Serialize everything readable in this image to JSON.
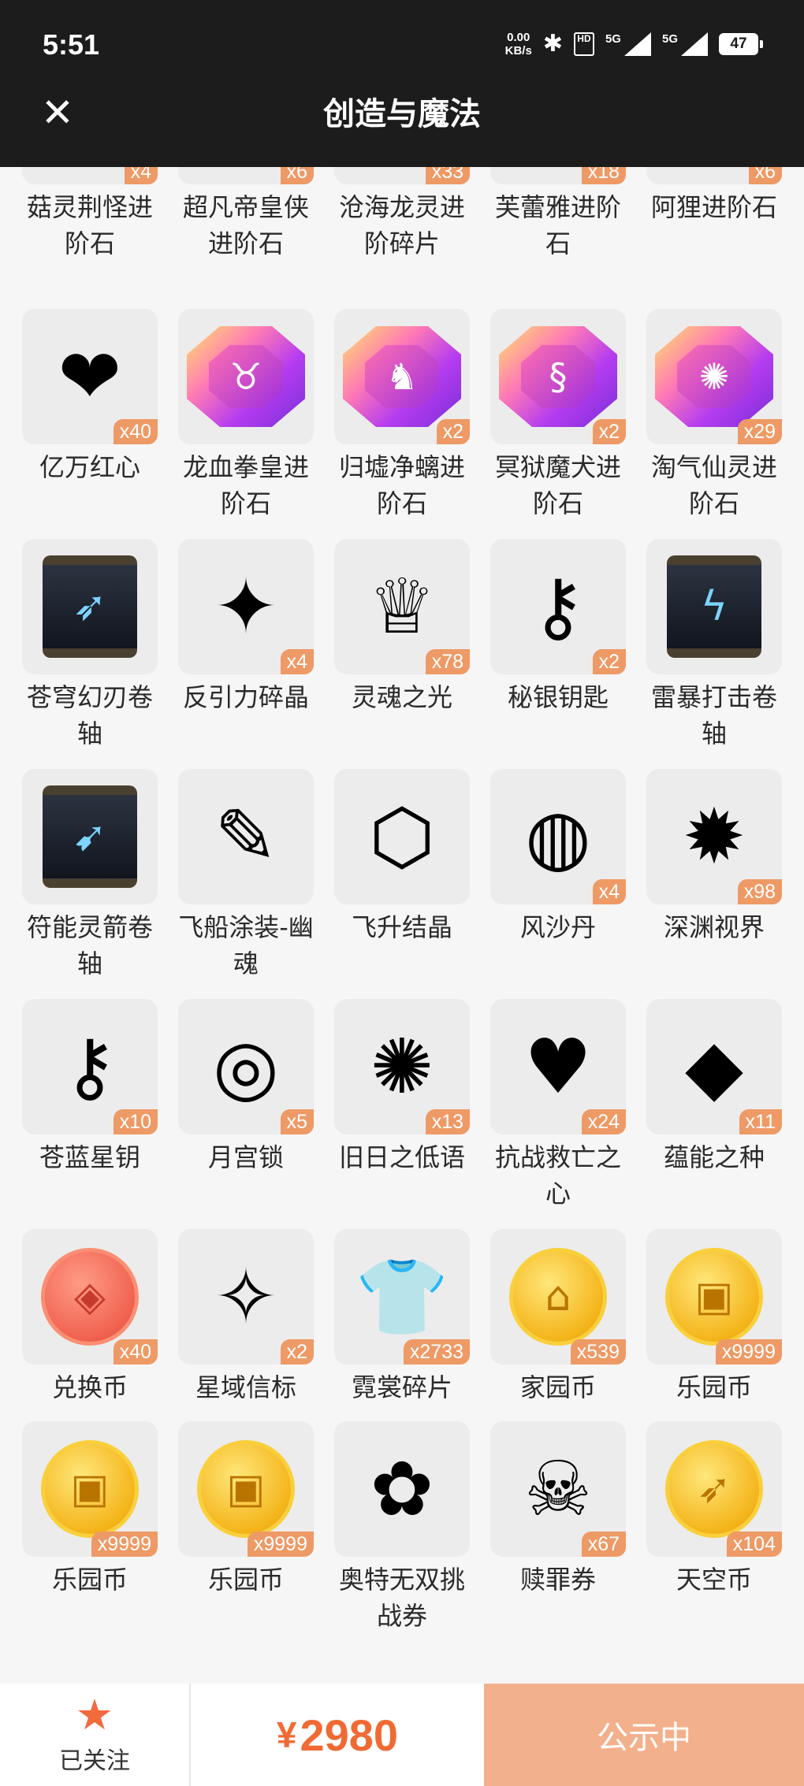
{
  "status_bar": {
    "time": "5:51",
    "net_speed_value": "0.00",
    "net_speed_unit": "KB/s",
    "bluetooth_icon": "bluetooth-icon",
    "hd_label": "HD",
    "signal1_label": "5G",
    "signal2_label": "5G",
    "battery": "47"
  },
  "header": {
    "close_icon": "✕",
    "title": "创造与魔法"
  },
  "items": [
    {
      "name": "菇灵荆怪进阶石",
      "count": "x4",
      "icon": "gem",
      "glyph": "♆"
    },
    {
      "name": "超凡帝皇侠进阶石",
      "count": "x6",
      "icon": "gem",
      "glyph": "♛"
    },
    {
      "name": "沧海龙灵进阶碎片",
      "count": "x33",
      "icon": "gem",
      "glyph": "♒"
    },
    {
      "name": "芙蕾雅进阶石",
      "count": "x18",
      "icon": "gem",
      "glyph": "❀"
    },
    {
      "name": "阿狸进阶石",
      "count": "x6",
      "icon": "gem",
      "glyph": "☾"
    },
    {
      "name": "亿万红心",
      "count": "x40",
      "icon": "emoji",
      "glyph": "❤"
    },
    {
      "name": "龙血拳皇进阶石",
      "count": "",
      "icon": "gem",
      "glyph": "♉"
    },
    {
      "name": "归墟净螭进阶石",
      "count": "x2",
      "icon": "gem",
      "glyph": "♞"
    },
    {
      "name": "冥狱魔犬进阶石",
      "count": "x2",
      "icon": "gem",
      "glyph": "§"
    },
    {
      "name": "淘气仙灵进阶石",
      "count": "x29",
      "icon": "gem",
      "glyph": "✺"
    },
    {
      "name": "苍穹幻刃卷轴",
      "count": "",
      "icon": "scroll",
      "glyph": "➶"
    },
    {
      "name": "反引力碎晶",
      "count": "x4",
      "icon": "emoji",
      "glyph": "✦"
    },
    {
      "name": "灵魂之光",
      "count": "x78",
      "icon": "emoji",
      "glyph": "♕"
    },
    {
      "name": "秘银钥匙",
      "count": "x2",
      "icon": "emoji",
      "glyph": "⚷"
    },
    {
      "name": "雷暴打击卷轴",
      "count": "",
      "icon": "scroll",
      "glyph": "ϟ"
    },
    {
      "name": "符能灵箭卷轴",
      "count": "",
      "icon": "scroll",
      "glyph": "➹"
    },
    {
      "name": "飞船涂装-幽魂",
      "count": "",
      "icon": "emoji",
      "glyph": "✎"
    },
    {
      "name": "飞升结晶",
      "count": "",
      "icon": "emoji",
      "glyph": "⬡"
    },
    {
      "name": "风沙丹",
      "count": "x4",
      "icon": "emoji",
      "glyph": "◍"
    },
    {
      "name": "深渊视界",
      "count": "x98",
      "icon": "emoji",
      "glyph": "✹"
    },
    {
      "name": "苍蓝星钥",
      "count": "x10",
      "icon": "emoji",
      "glyph": "⚷"
    },
    {
      "name": "月宫锁",
      "count": "x5",
      "icon": "emoji",
      "glyph": "◎"
    },
    {
      "name": "旧日之低语",
      "count": "x13",
      "icon": "emoji",
      "glyph": "✺"
    },
    {
      "name": "抗战救亡之心",
      "count": "x24",
      "icon": "emoji",
      "glyph": "♥"
    },
    {
      "name": "蕴能之种",
      "count": "x11",
      "icon": "emoji",
      "glyph": "◆"
    },
    {
      "name": "兑换币",
      "count": "x40",
      "icon": "coin-red",
      "glyph": "◈"
    },
    {
      "name": "星域信标",
      "count": "x2",
      "icon": "emoji",
      "glyph": "✧"
    },
    {
      "name": "霓裳碎片",
      "count": "x2733",
      "icon": "emoji",
      "glyph": "👕"
    },
    {
      "name": "家园币",
      "count": "x539",
      "icon": "coin",
      "glyph": "⌂"
    },
    {
      "name": "乐园币",
      "count": "x9999",
      "icon": "coin",
      "glyph": "▣"
    },
    {
      "name": "乐园币",
      "count": "x9999",
      "icon": "coin",
      "glyph": "▣"
    },
    {
      "name": "乐园币",
      "count": "x9999",
      "icon": "coin",
      "glyph": "▣"
    },
    {
      "name": "奥特无双挑战券",
      "count": "",
      "icon": "emoji",
      "glyph": "✿"
    },
    {
      "name": "赎罪券",
      "count": "x67",
      "icon": "emoji",
      "glyph": "☠"
    },
    {
      "name": "天空币",
      "count": "x104",
      "icon": "coin",
      "glyph": "➶"
    }
  ],
  "bottom_bar": {
    "follow_label": "已关注",
    "currency": "¥",
    "price": "2980",
    "action_label": "公示中"
  }
}
